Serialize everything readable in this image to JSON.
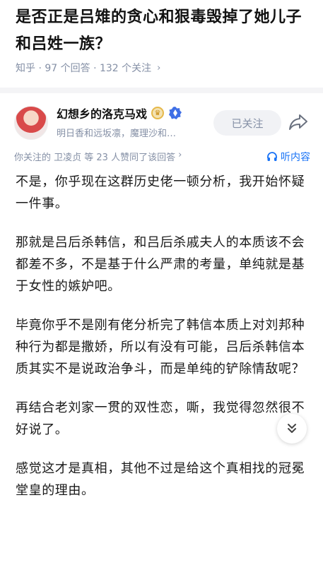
{
  "question": {
    "title": "是否正是吕雉的贪心和狠毒毁掉了她儿子和吕姓一族？",
    "meta": "知乎 · 97 个回答 · 132 个关注",
    "meta_chevron": "›"
  },
  "author": {
    "name": "幻想乡的洛克马戏",
    "description": "明日香和远坂凛，魔理沙和…",
    "follow_label": "已关注"
  },
  "endorsement": {
    "text": "你关注的 卫凌贞 等 23 人赞同了该回答",
    "chevron": "›"
  },
  "listen_label": "听内容",
  "answer": {
    "paragraphs": [
      "不是，你乎现在这群历史佬一顿分析，我开始怀疑一件事。",
      "那就是吕后杀韩信，和吕后杀戚夫人的本质该不会都差不多，不是基于什么严肃的考量，单纯就是基于女性的嫉妒吧。",
      "毕竟你乎不是刚有佬分析完了韩信本质上对刘邦种种行为都是撒娇，所以有没有可能，吕后杀韩信本质其实不是说政治争斗，而是单纯的铲除情敌呢？",
      "再结合老刘家一贯的双性恋，嘶，我觉得忽然很不好说了。",
      "感觉这才是真相，其他不过是给这个真相找的冠冕堂皇的理由。"
    ]
  },
  "colors": {
    "accent": "#1772f6",
    "muted": "#8590a6",
    "text": "#1a1a1a"
  }
}
